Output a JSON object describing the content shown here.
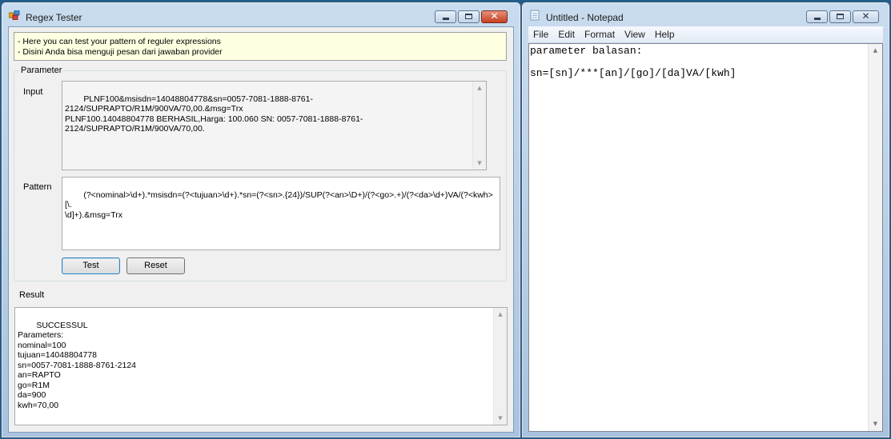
{
  "regex_window": {
    "title": "Regex Tester",
    "info_lines": [
      "- Here you can test your pattern of reguler expressions",
      "- Disini Anda bisa menguji pesan dari jawaban provider"
    ],
    "parameter_group_label": "Parameter",
    "input_label": "Input",
    "input_value": "PLNF100&msisdn=14048804778&sn=0057-7081-1888-8761-2124/SUPRAPTO/R1M/900VA/70,00.&msg=Trx\nPLNF100.14048804778 BERHASIL,Harga: 100.060 SN: 0057-7081-1888-8761-\n2124/SUPRAPTO/R1M/900VA/70,00.",
    "pattern_label": "Pattern",
    "pattern_value": "(?<nominal>\\d+).*msisdn=(?<tujuan>\\d+).*sn=(?<sn>.{24})/SUP(?<an>\\D+)/(?<go>.+)/(?<da>\\d+)VA/(?<kwh>[\\.\n\\d]+).&msg=Trx",
    "test_button": "Test",
    "reset_button": "Reset",
    "result_group_label": "Result",
    "result_value": "SUCCESSUL\nParameters:\nnominal=100\ntujuan=14048804778\nsn=0057-7081-1888-8761-2124\nan=RAPTO\ngo=R1M\nda=900\nkwh=70,00"
  },
  "notepad_window": {
    "title": "Untitled - Notepad",
    "menu": [
      "File",
      "Edit",
      "Format",
      "View",
      "Help"
    ],
    "content": "parameter balasan:\n\nsn=[sn]/***[an]/[go]/[da]VA/[kwh]"
  },
  "colors": {
    "desktop": "#1f5f8a",
    "info_background": "#ffffe1",
    "close_button": "#c63f21"
  }
}
